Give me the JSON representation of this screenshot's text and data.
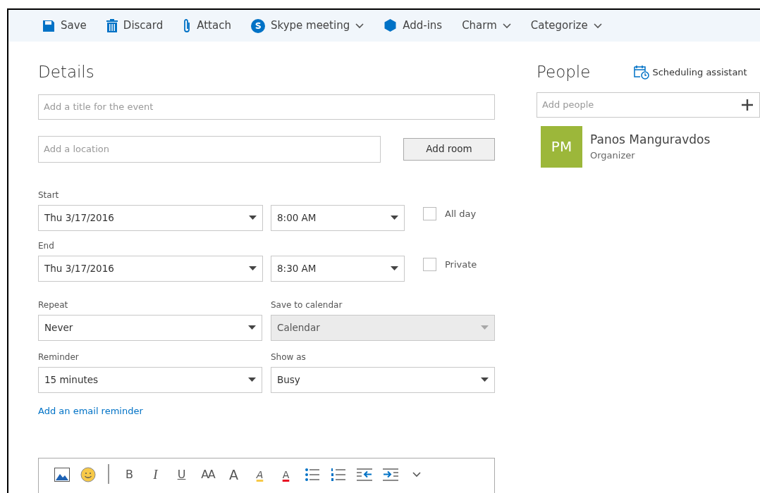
{
  "toolbar": [
    {
      "kind": "save",
      "label": "Save",
      "dropdown": false
    },
    {
      "kind": "discard",
      "label": "Discard",
      "dropdown": false
    },
    {
      "kind": "attach",
      "label": "Attach",
      "dropdown": false
    },
    {
      "kind": "skype",
      "label": "Skype meeting",
      "dropdown": true
    },
    {
      "kind": "addins",
      "label": "Add-ins",
      "dropdown": false
    },
    {
      "kind": "none",
      "label": "Charm",
      "dropdown": true
    },
    {
      "kind": "none",
      "label": "Categorize",
      "dropdown": true
    }
  ],
  "details": {
    "heading": "Details",
    "title_field": {
      "placeholder": "Add a title for the event"
    },
    "location_field": {
      "placeholder": "Add a location"
    },
    "add_room": "Add room",
    "start": {
      "label": "Start",
      "date": "Thu 3/17/2016",
      "time": "8:00 AM"
    },
    "end": {
      "label": "End",
      "date": "Thu 3/17/2016",
      "time": "8:30 AM"
    },
    "options": [
      {
        "label": "All day",
        "checked": false
      },
      {
        "label": "Private",
        "checked": false
      }
    ],
    "repeat": {
      "label": "Repeat",
      "value": "Never",
      "disabled": false
    },
    "save_to_calendar": {
      "label": "Save to calendar",
      "value": "Calendar",
      "disabled": true
    },
    "reminder": {
      "label": "Reminder",
      "value": "15 minutes",
      "disabled": false
    },
    "show_as": {
      "label": "Show as",
      "value": "Busy",
      "disabled": false
    },
    "email_reminder_link": "Add an email reminder",
    "editor_tools": [
      {
        "kind": "image"
      },
      {
        "kind": "emoji"
      },
      {
        "kind": "separator"
      },
      {
        "kind": "bold",
        "label": "B"
      },
      {
        "kind": "italic",
        "label": "I"
      },
      {
        "kind": "underline",
        "label": "U"
      },
      {
        "kind": "font-size",
        "label": "AA"
      },
      {
        "kind": "grow",
        "label": "A"
      },
      {
        "kind": "highlight",
        "label": "A"
      },
      {
        "kind": "font-color",
        "label": "A"
      },
      {
        "kind": "bullets"
      },
      {
        "kind": "numbering"
      },
      {
        "kind": "outdent"
      },
      {
        "kind": "indent"
      },
      {
        "kind": "more"
      }
    ]
  },
  "people": {
    "heading": "People",
    "scheduling": "Scheduling assistant",
    "add_field": {
      "placeholder": "Add people"
    },
    "attendees": [
      {
        "initials": "PM",
        "name": "Panos Manguravdos",
        "role": "Organizer",
        "color": "#9cb73a"
      }
    ]
  }
}
